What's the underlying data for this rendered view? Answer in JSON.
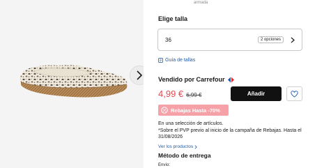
{
  "product": {
    "subtitle_fragment": "armada",
    "image_alt": "espadrille-shoe-image"
  },
  "size": {
    "title": "Elige talla",
    "selected": "36",
    "options_badge": "2 opciones",
    "guide_link": "Guía de tallas"
  },
  "seller": {
    "label": "Vendido por Carrefour"
  },
  "price": {
    "current": "4,99 €",
    "original": "6,99 €"
  },
  "actions": {
    "add_label": "Añadir",
    "favorite_icon": "heart-icon"
  },
  "promo": {
    "badge": "Rebajas Hasta -70%",
    "line1": "En una selección de artículos.",
    "line2": "*Sobre el PVP previo al inicio de la campaña de Rebajas. Hasta el 31/08/2026",
    "see_products": "Ver los productos"
  },
  "delivery": {
    "title": "Método de entrega",
    "shipping_label": "Envío:"
  },
  "colors": {
    "price_red": "#e8474f",
    "promo_pink": "#f6a1a7",
    "link_blue": "#1e5aa8",
    "button_black": "#111111",
    "carrefour_blue": "#1e5aa8",
    "carrefour_red": "#e2312f"
  }
}
